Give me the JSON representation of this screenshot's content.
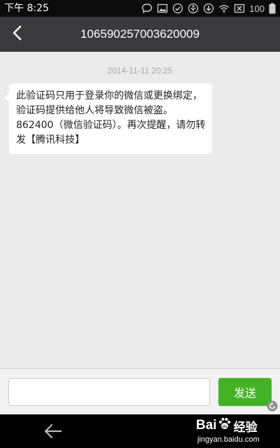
{
  "status_bar": {
    "time": "下午 8:25",
    "battery_percent": "100",
    "icons": [
      "chat-bubble-icon",
      "image-icon",
      "check-circle-icon",
      "usb-icon",
      "download-icon",
      "wifi-icon",
      "signal-off-icon",
      "battery-icon"
    ]
  },
  "header": {
    "back_icon": "chevron-left-icon",
    "title": "106590257003620009"
  },
  "conversation": {
    "timestamp": "2014-11-11 20:25",
    "messages": [
      {
        "direction": "incoming",
        "text": "此验证码只用于登录你的微信或更换绑定，验证码提供给他人将导致微信被盗。862400（微信验证码）。再次提醒，请勿转发【腾讯科技】"
      }
    ]
  },
  "composer": {
    "input_value": "",
    "send_label": "发送"
  },
  "nav_bar": {
    "back_icon": "back-arrow-icon"
  },
  "watermark": {
    "brand_left": "Bai",
    "brand_right": "经验",
    "url": "jingyan.baidu.com"
  },
  "colors": {
    "status_bar": "#0c0c0c",
    "header": "#3a3a3c",
    "chat_background": "#ebebeb",
    "bubble": "#ffffff",
    "send_button": "#43b325",
    "nav_bar": "#000000"
  }
}
